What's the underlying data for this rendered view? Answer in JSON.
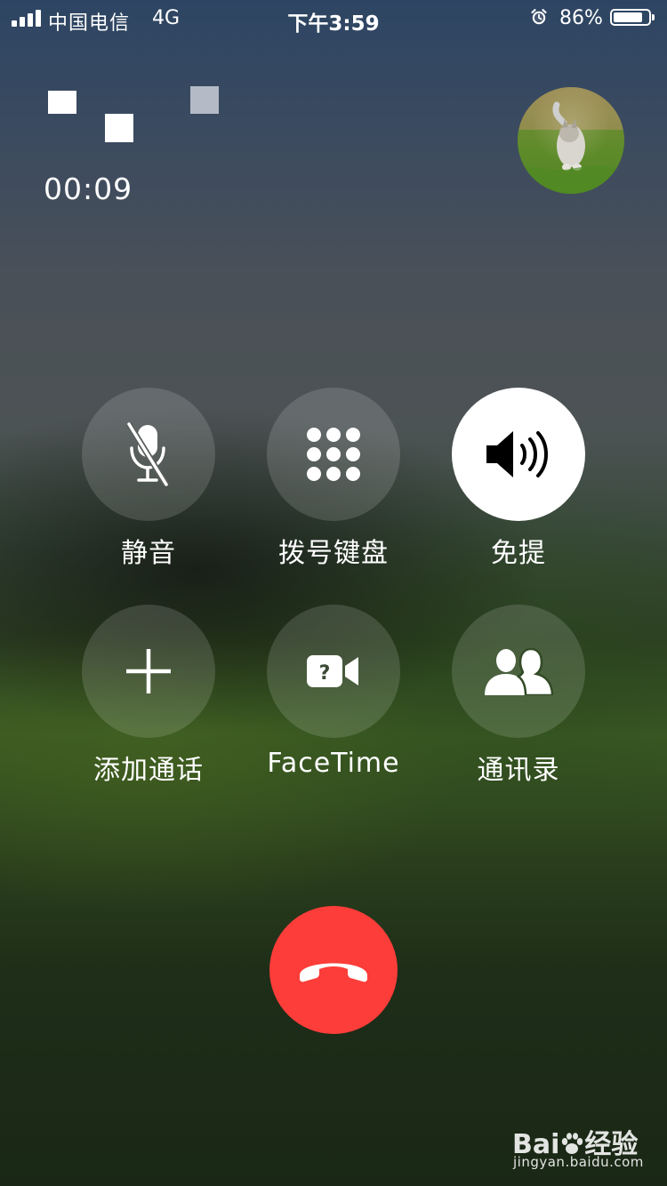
{
  "status_bar": {
    "carrier": "中国电信",
    "network": "4G",
    "time": "下午3:59",
    "battery_percent_text": "86%",
    "battery_level": 0.86,
    "signal_bars": 4,
    "icons": [
      "signal-icon",
      "alarm-icon",
      "battery-icon"
    ]
  },
  "call": {
    "timer": "00:09",
    "caller_name_redacted": true,
    "avatar": "caller-avatar-photo"
  },
  "controls": [
    {
      "id": "mute",
      "label": "静音",
      "icon": "mic-off-icon",
      "active": false
    },
    {
      "id": "keypad",
      "label": "拨号键盘",
      "icon": "keypad-icon",
      "active": false
    },
    {
      "id": "speaker",
      "label": "免提",
      "icon": "speaker-icon",
      "active": true
    },
    {
      "id": "add-call",
      "label": "添加通话",
      "icon": "plus-icon",
      "active": false
    },
    {
      "id": "facetime",
      "label": "FaceTime",
      "icon": "facetime-icon",
      "active": false
    },
    {
      "id": "contacts",
      "label": "通讯录",
      "icon": "contacts-icon",
      "active": false
    }
  ],
  "end_call": {
    "icon": "end-call-icon",
    "color": "#fc3d39"
  },
  "watermark": {
    "brand_left": "Bai",
    "brand_right": "经验",
    "url": "jingyan.baidu.com"
  },
  "colors": {
    "control_bg": "rgba(255,255,255,0.14)",
    "control_active_bg": "#ffffff",
    "end_call_red": "#fc3d39"
  }
}
